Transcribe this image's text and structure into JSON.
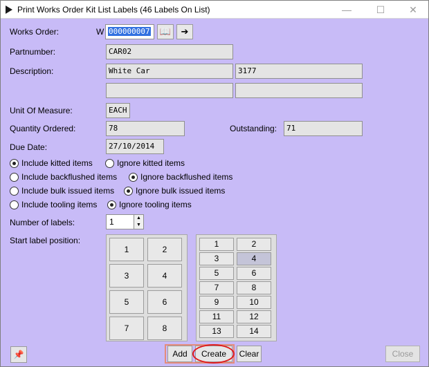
{
  "window": {
    "title": "Print Works Order Kit List Labels (46 Labels On List)",
    "minimize_glyph": "—",
    "maximize_glyph": "☐",
    "close_glyph": "✕"
  },
  "form": {
    "works_order": {
      "label": "Works Order:",
      "prefix": "W",
      "value": "000000007"
    },
    "partnumber": {
      "label": "Partnumber:",
      "value": "CAR02"
    },
    "description": {
      "label": "Description:",
      "line1": "White Car",
      "code": "3177",
      "line2": "",
      "line3": ""
    },
    "unit_of_measure": {
      "label": "Unit Of Measure:",
      "value": "EACH"
    },
    "quantity_ordered": {
      "label": "Quantity Ordered:",
      "value": "78"
    },
    "outstanding": {
      "label": "Outstanding:",
      "value": "71"
    },
    "due_date": {
      "label": "Due Date:",
      "value": "27/10/2014"
    },
    "options": {
      "kitted": {
        "include": "Include kitted items",
        "ignore": "Ignore kitted items",
        "selected": "include"
      },
      "backflushed": {
        "include": "Include backflushed items",
        "ignore": "Ignore backflushed items",
        "selected": "ignore"
      },
      "bulk": {
        "include": "Include bulk issued items",
        "ignore": "Ignore bulk issued items",
        "selected": "ignore"
      },
      "tooling": {
        "include": "Include tooling items",
        "ignore": "Ignore tooling items",
        "selected": "ignore"
      }
    },
    "number_of_labels": {
      "label": "Number of labels:",
      "value": "1"
    },
    "start_label_position": {
      "label": "Start label position:"
    }
  },
  "label_grid_large": [
    "1",
    "2",
    "3",
    "4",
    "5",
    "6",
    "7",
    "8"
  ],
  "label_grid_small": [
    "1",
    "2",
    "3",
    "4",
    "5",
    "6",
    "7",
    "8",
    "9",
    "10",
    "11",
    "12",
    "13",
    "14"
  ],
  "label_grid_small_selected": "4",
  "buttons": {
    "add": "Add",
    "create": "Create",
    "clear": "Clear",
    "close": "Close",
    "book_icon": "📖",
    "arrow_icon": "➔",
    "pin_icon": "📌"
  },
  "colors": {
    "background": "#c8bbf7",
    "selection": "#3271e0",
    "highlight_box": "#e58c7a",
    "highlight_oval": "#e0191b"
  }
}
